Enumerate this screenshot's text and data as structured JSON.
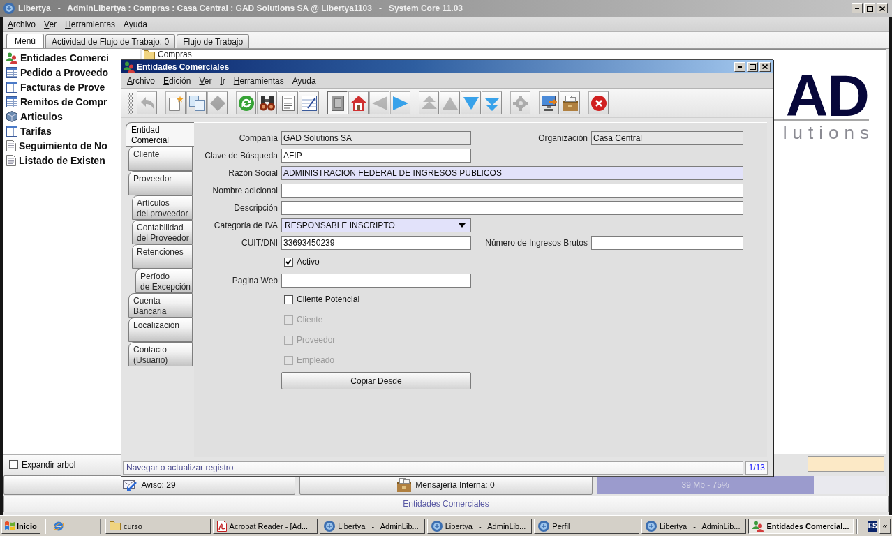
{
  "main_window": {
    "title": "Libertya   -   AdminLibertya : Compras : Casa Central : GAD Solutions SA @ Libertya1103   -   System Core 11.03",
    "menu": [
      {
        "label": "Archivo",
        "mnemonic": true
      },
      {
        "label": "Ver",
        "mnemonic": true
      },
      {
        "label": "Herramientas",
        "mnemonic": true
      },
      {
        "label": "Ayuda",
        "mnemonic": false
      }
    ],
    "tabs": [
      {
        "label": "Menú",
        "selected": true
      },
      {
        "label": "Actividad de Flujo de Trabajo: 0",
        "selected": false
      },
      {
        "label": "Flujo de Trabajo",
        "selected": false
      }
    ],
    "menu_tree": {
      "items": [
        {
          "label": "Entidades Comerci",
          "kind": "partner"
        },
        {
          "label": "Pedido a Proveedo",
          "kind": "window"
        },
        {
          "label": "Facturas de Prove",
          "kind": "window"
        },
        {
          "label": "Remitos de Compr",
          "kind": "window"
        },
        {
          "label": "Articulos",
          "kind": "product"
        },
        {
          "label": "Tarifas",
          "kind": "window"
        },
        {
          "label": "Seguimiento de No",
          "kind": "report"
        },
        {
          "label": "Listado de Existen",
          "kind": "report"
        }
      ],
      "expand_tree": {
        "label": "Expandir arbol",
        "checked": false
      }
    },
    "workflow_tree": {
      "root": "Compras"
    },
    "logo": {
      "mark": "AD",
      "wordmark": "lutions"
    },
    "notices": "Aviso: 29",
    "messages": "Mensajería Interna: 0",
    "memory": {
      "reading": "39 Mb - 75%",
      "level": 0.75
    },
    "status_bar": "Entidades Comerciales"
  },
  "dialog": {
    "title": "Entidades Comerciales",
    "menu": [
      {
        "label": "Archivo",
        "mnemonic": true
      },
      {
        "label": "Edición",
        "mnemonic": true
      },
      {
        "label": "Ver",
        "mnemonic": true
      },
      {
        "label": "Ir",
        "mnemonic": true
      },
      {
        "label": "Herramientas",
        "mnemonic": true
      },
      {
        "label": "Ayuda",
        "mnemonic": false
      }
    ],
    "toolbar": [
      {
        "buttons": [
          {
            "disabled": true,
            "pressed": false
          }
        ]
      },
      {
        "buttons": [
          {
            "disabled": false,
            "pressed": false
          },
          {
            "disabled": false,
            "pressed": false
          },
          {
            "disabled": true,
            "pressed": false
          }
        ]
      },
      {
        "buttons": [
          {
            "disabled": false,
            "pressed": false
          },
          {
            "disabled": false,
            "pressed": false
          },
          {
            "disabled": false,
            "pressed": false
          },
          {
            "disabled": false,
            "pressed": false
          }
        ]
      },
      {
        "buttons": [
          {
            "disabled": false,
            "pressed": true
          },
          {
            "disabled": false,
            "pressed": false
          },
          {
            "disabled": true,
            "pressed": false
          },
          {
            "disabled": false,
            "pressed": false
          }
        ]
      },
      {
        "buttons": [
          {
            "disabled": true,
            "pressed": false
          },
          {
            "disabled": true,
            "pressed": false
          },
          {
            "disabled": false,
            "pressed": false
          },
          {
            "disabled": false,
            "pressed": false
          }
        ]
      },
      {
        "buttons": [
          {
            "disabled": true,
            "pressed": false
          }
        ]
      },
      {
        "buttons": [
          {
            "disabled": false,
            "pressed": false
          },
          {
            "disabled": false,
            "pressed": false
          }
        ]
      },
      {
        "buttons": [
          {
            "disabled": false,
            "pressed": false
          }
        ]
      }
    ],
    "tabs": [
      {
        "label": "Entidad\nComercial",
        "selected": true,
        "children": [
          {
            "label": "Cliente",
            "selected": false
          },
          {
            "label": "Proveedor",
            "selected": false,
            "children": [
              {
                "label": "Artículos\ndel proveedor",
                "selected": false
              },
              {
                "label": "Contabilidad\ndel Proveedor",
                "selected": false
              },
              {
                "label": "Retenciones",
                "selected": false,
                "children": [
                  {
                    "label": "Período\nde Excepción",
                    "selected": false
                  }
                ]
              }
            ]
          },
          {
            "label": "Cuenta\nBancaria",
            "selected": false
          },
          {
            "label": "Localización",
            "selected": false
          },
          {
            "label": "Contacto\n(Usuario)",
            "selected": false
          }
        ]
      }
    ],
    "form": {
      "rows": [
        {
          "fields": [
            {
              "kind": "text",
              "label": "Compañía",
              "value": "GAD Solutions SA",
              "readonly": true,
              "mandatory": false
            },
            {
              "kind": "text",
              "label": "Organización",
              "value": "Casa Central",
              "readonly": true,
              "mandatory": false
            }
          ]
        },
        {
          "fields": [
            {
              "kind": "text",
              "label": "Clave de Búsqueda",
              "value": "AFIP",
              "readonly": false,
              "mandatory": false
            }
          ]
        },
        {
          "fields": [
            {
              "kind": "text",
              "label": "Razón Social",
              "value": "ADMINISTRACION FEDERAL DE INGRESOS PUBLICOS",
              "readonly": false,
              "mandatory": true
            }
          ]
        },
        {
          "fields": [
            {
              "kind": "text",
              "label": "Nombre adicional",
              "readonly": false,
              "mandatory": false
            }
          ]
        },
        {
          "fields": [
            {
              "kind": "text",
              "label": "Descripción",
              "readonly": false,
              "mandatory": false
            }
          ]
        },
        {
          "fields": [
            {
              "kind": "combo",
              "label": "Categoría de IVA",
              "value": "RESPONSABLE INSCRIPTO",
              "readonly": false,
              "mandatory": true
            }
          ]
        },
        {
          "fields": [
            {
              "kind": "text",
              "label": "CUIT/DNI",
              "value": "33693450239",
              "readonly": false,
              "mandatory": false
            },
            {
              "kind": "text",
              "label": "Número de Ingresos Brutos",
              "readonly": false,
              "mandatory": false
            }
          ]
        },
        {
          "fields": [
            {
              "kind": "checkbox",
              "label": "Activo",
              "checked": true,
              "disabled": false
            }
          ]
        },
        {
          "fields": [
            {
              "kind": "text",
              "label": "Pagina Web",
              "readonly": false,
              "mandatory": false
            }
          ]
        },
        {
          "fields": [
            {
              "kind": "checkbox",
              "label": "Cliente Potencial",
              "checked": false,
              "disabled": false
            }
          ]
        },
        {
          "fields": [
            {
              "kind": "checkbox",
              "label": "Cliente",
              "checked": false,
              "disabled": true
            }
          ]
        },
        {
          "fields": [
            {
              "kind": "checkbox",
              "label": "Proveedor",
              "checked": false,
              "disabled": true
            }
          ]
        },
        {
          "fields": [
            {
              "kind": "checkbox",
              "label": "Empleado",
              "checked": false,
              "disabled": true
            }
          ]
        },
        {
          "fields": [
            {
              "kind": "button",
              "label": "Copiar Desde"
            }
          ]
        }
      ]
    },
    "status": {
      "text": "Navegar o actualizar registro",
      "record": "1/13"
    }
  },
  "taskbar": {
    "start": "Inicio",
    "tasks": [
      {
        "label": "curso",
        "kind": "folder",
        "selected": false
      },
      {
        "label": "Acrobat Reader - [Ad...",
        "kind": "pdf",
        "selected": false
      },
      {
        "label": "Libertya   -   AdminLib...",
        "kind": "app",
        "selected": false
      },
      {
        "label": "Libertya   -   AdminLib...",
        "kind": "app",
        "selected": false
      },
      {
        "label": "Perfil",
        "kind": "app",
        "selected": false
      },
      {
        "label": "Libertya   -   AdminLib...",
        "kind": "app",
        "selected": false
      },
      {
        "label": "Entidades Comercial...",
        "kind": "partner",
        "selected": true
      }
    ],
    "language": "ES",
    "collapse": "«"
  }
}
